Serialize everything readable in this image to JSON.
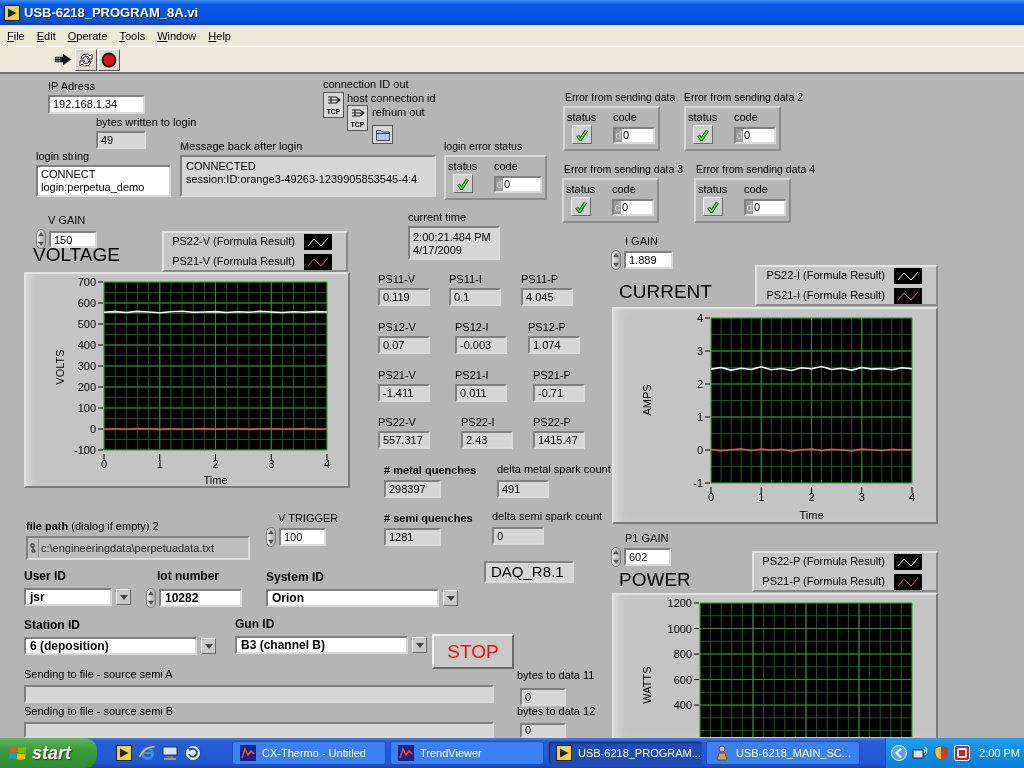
{
  "window": {
    "title": "USB-6218_PROGRAM_8A.vi"
  },
  "menu": [
    "File",
    "Edit",
    "Operate",
    "Tools",
    "Window",
    "Help"
  ],
  "panel": {
    "ip_address": {
      "label": "IP Adress",
      "value": "192.168.1.34"
    },
    "bytes_written_to_login": {
      "label": "bytes written to login",
      "value": "49"
    },
    "login_string": {
      "label": "login string",
      "lines": [
        "CONNECT",
        "login:perpetua_demo"
      ]
    },
    "message_back": {
      "label": "Message back after login",
      "lines": [
        "CONNECTED",
        "session:ID:orange3-49263-1239905853545-4:4"
      ]
    },
    "refnums": [
      {
        "kind": "tcp",
        "label": "connection ID out",
        "badge": "TCP"
      },
      {
        "kind": "tcp",
        "label": "host connection id",
        "badge": "TCP"
      },
      {
        "kind": "file",
        "label": "refnum out"
      }
    ],
    "error_clusters": [
      {
        "label": "login error status",
        "status_label": "status",
        "checked": true,
        "code_label": "code",
        "radix": "d",
        "code": "0"
      },
      {
        "label": "Error from sending data",
        "status_label": "status",
        "checked": true,
        "code_label": "code",
        "radix": "d",
        "code": "0"
      },
      {
        "label": "Error from sending data 2",
        "status_label": "status",
        "checked": true,
        "code_label": "code",
        "radix": "d",
        "code": "0"
      },
      {
        "label": "Error from sending data 3",
        "status_label": "status",
        "checked": true,
        "code_label": "code",
        "radix": "d",
        "code": "0"
      },
      {
        "label": "Error from sending data 4",
        "status_label": "status",
        "checked": true,
        "code_label": "code",
        "radix": "d",
        "code": "0"
      }
    ],
    "current_time": {
      "label": "current time",
      "lines": [
        "2:00:21.484 PM",
        "4/17/2009"
      ]
    },
    "voltage_graph": {
      "gain": {
        "label": "V GAIN",
        "value": "150"
      },
      "chart_data": {
        "type": "line",
        "title": "VOLTAGE",
        "xlabel": "Time",
        "ylabel": "VOLTS",
        "grid": true,
        "xlim": [
          0,
          4
        ],
        "ylim": [
          -100,
          700
        ],
        "xticks": [
          0,
          1,
          2,
          3,
          4
        ],
        "yticks": [
          -100,
          0,
          100,
          200,
          300,
          400,
          500,
          600,
          700
        ],
        "x": [
          0,
          0.2,
          0.4,
          0.6,
          0.8,
          1,
          1.2,
          1.4,
          1.6,
          1.8,
          2,
          2.2,
          2.4,
          2.6,
          2.8,
          3,
          3.2,
          3.4,
          3.6,
          3.8,
          4
        ],
        "series": [
          {
            "name": "PS22-V (Formula Result)",
            "color": "#ffffff",
            "values": [
              556,
              559,
              555,
              560,
              557,
              554,
              558,
              561,
              556,
              557,
              559,
              555,
              558,
              556,
              560,
              557,
              555,
              558,
              556,
              559,
              557
            ]
          },
          {
            "name": "PS21-V (Formula Result)",
            "color": "#e85050",
            "values": [
              -2,
              1,
              -1,
              2,
              0,
              -2,
              1,
              -1,
              0,
              2,
              -1,
              0,
              1,
              -2,
              0,
              1,
              -1,
              0,
              2,
              -1,
              0
            ]
          }
        ]
      }
    },
    "readings": [
      {
        "label": "PS11-V",
        "value": "0.119"
      },
      {
        "label": "PS11-I",
        "value": "0.1"
      },
      {
        "label": "PS11-P",
        "value": "4.045"
      },
      {
        "label": "PS12-V",
        "value": "0.07"
      },
      {
        "label": "PS12-I",
        "value": "-0.003"
      },
      {
        "label": "PS12-P",
        "value": "1.074"
      },
      {
        "label": "PS21-V",
        "value": "-1.411"
      },
      {
        "label": "PS21-I",
        "value": "0.011"
      },
      {
        "label": "PS21-P",
        "value": "-0.71"
      },
      {
        "label": "PS22-V",
        "value": "557.317"
      },
      {
        "label": "PS22-I",
        "value": "2.43"
      },
      {
        "label": "PS22-P",
        "value": "1415.47"
      }
    ],
    "metal_quenches": {
      "label": "# metal quenches",
      "value": "298397"
    },
    "delta_metal_spark_count": {
      "label": "delta metal spark count",
      "value": "491"
    },
    "semi_quenches": {
      "label": "# semi quenches",
      "value": "1281"
    },
    "delta_semi_spark_count": {
      "label": "delta semi spark count",
      "value": "0"
    },
    "version": "DAQ_R8.1",
    "file_path": {
      "label": "**file path** (dialog if empty) 2",
      "value": "c:\\engineeringdata\\perpetuadata.txt"
    },
    "v_trigger": {
      "label": "V TRIGGER",
      "value": "100"
    },
    "user_id": {
      "label": "User ID",
      "value": "jsr"
    },
    "lot_number": {
      "label": "lot number",
      "value": "10282"
    },
    "system_id": {
      "label": "System ID",
      "value": "Orion"
    },
    "station_id": {
      "label": "Station ID",
      "value": "6 (deposition)"
    },
    "gun_id": {
      "label": "Gun ID",
      "value": "B3 (channel B)"
    },
    "stop_button": {
      "label": "STOP"
    },
    "file_status": [
      {
        "label": "Sending to file - source semi A"
      },
      {
        "label": "Sending to file - source semi B"
      }
    ],
    "bytes_to_data": [
      {
        "label": "bytes to data 11",
        "value": "0"
      },
      {
        "label": "bytes to data 12",
        "value": "0"
      }
    ],
    "current_graph": {
      "gain": {
        "label": "I GAIN",
        "value": "1.889"
      },
      "chart_data": {
        "type": "line",
        "title": "CURRENT",
        "xlabel": "Time",
        "ylabel": "AMPS",
        "grid": true,
        "xlim": [
          0,
          4
        ],
        "ylim": [
          -1,
          4
        ],
        "xticks": [
          0,
          1,
          2,
          3,
          4
        ],
        "yticks": [
          -1,
          0,
          1,
          2,
          3,
          4
        ],
        "x": [
          0,
          0.2,
          0.4,
          0.6,
          0.8,
          1,
          1.2,
          1.4,
          1.6,
          1.8,
          2,
          2.2,
          2.4,
          2.6,
          2.8,
          3,
          3.2,
          3.4,
          3.6,
          3.8,
          4
        ],
        "series": [
          {
            "name": "PS22-I (Formula Result)",
            "color": "#ffffff",
            "values": [
              2.45,
              2.5,
              2.42,
              2.48,
              2.44,
              2.52,
              2.43,
              2.47,
              2.41,
              2.49,
              2.46,
              2.53,
              2.44,
              2.48,
              2.42,
              2.5,
              2.45,
              2.47,
              2.43,
              2.49,
              2.46
            ]
          },
          {
            "name": "PS21-I (Formula Result)",
            "color": "#e85050",
            "values": [
              0.02,
              -0.03,
              0.01,
              0.04,
              -0.02,
              0.03,
              -0.01,
              0.02,
              -0.04,
              0.01,
              0.03,
              -0.02,
              0.02,
              0,
              -0.03,
              0.03,
              0.01,
              -0.02,
              0.02,
              0,
              0.01
            ]
          }
        ]
      }
    },
    "power_graph": {
      "gain": {
        "label": "P1 GAIN",
        "value": "602"
      },
      "chart_data": {
        "type": "line",
        "title": "POWER",
        "ylabel": "WATTS",
        "grid": true,
        "ylim": [
          150,
          1200
        ],
        "yticks": [
          400,
          600,
          800,
          1000,
          1200
        ],
        "series": [
          {
            "name": "PS22-P (Formula Result)",
            "color": "#ffffff"
          },
          {
            "name": "PS21-P (Formula Result)",
            "color": "#e85050"
          }
        ]
      }
    }
  },
  "taskbar": {
    "start": "start",
    "tasks": [
      {
        "kind": "chart",
        "label": "CX-Thermo - Untitled",
        "selected": false
      },
      {
        "kind": "chart",
        "label": "TrendViewer",
        "selected": false
      },
      {
        "kind": "vi",
        "label": "USB-6218_PROGRAM...",
        "selected": true
      },
      {
        "kind": "figure",
        "label": "USB-6218_MAIN_SC...",
        "selected": false
      }
    ],
    "clock": "2:00 PM"
  }
}
